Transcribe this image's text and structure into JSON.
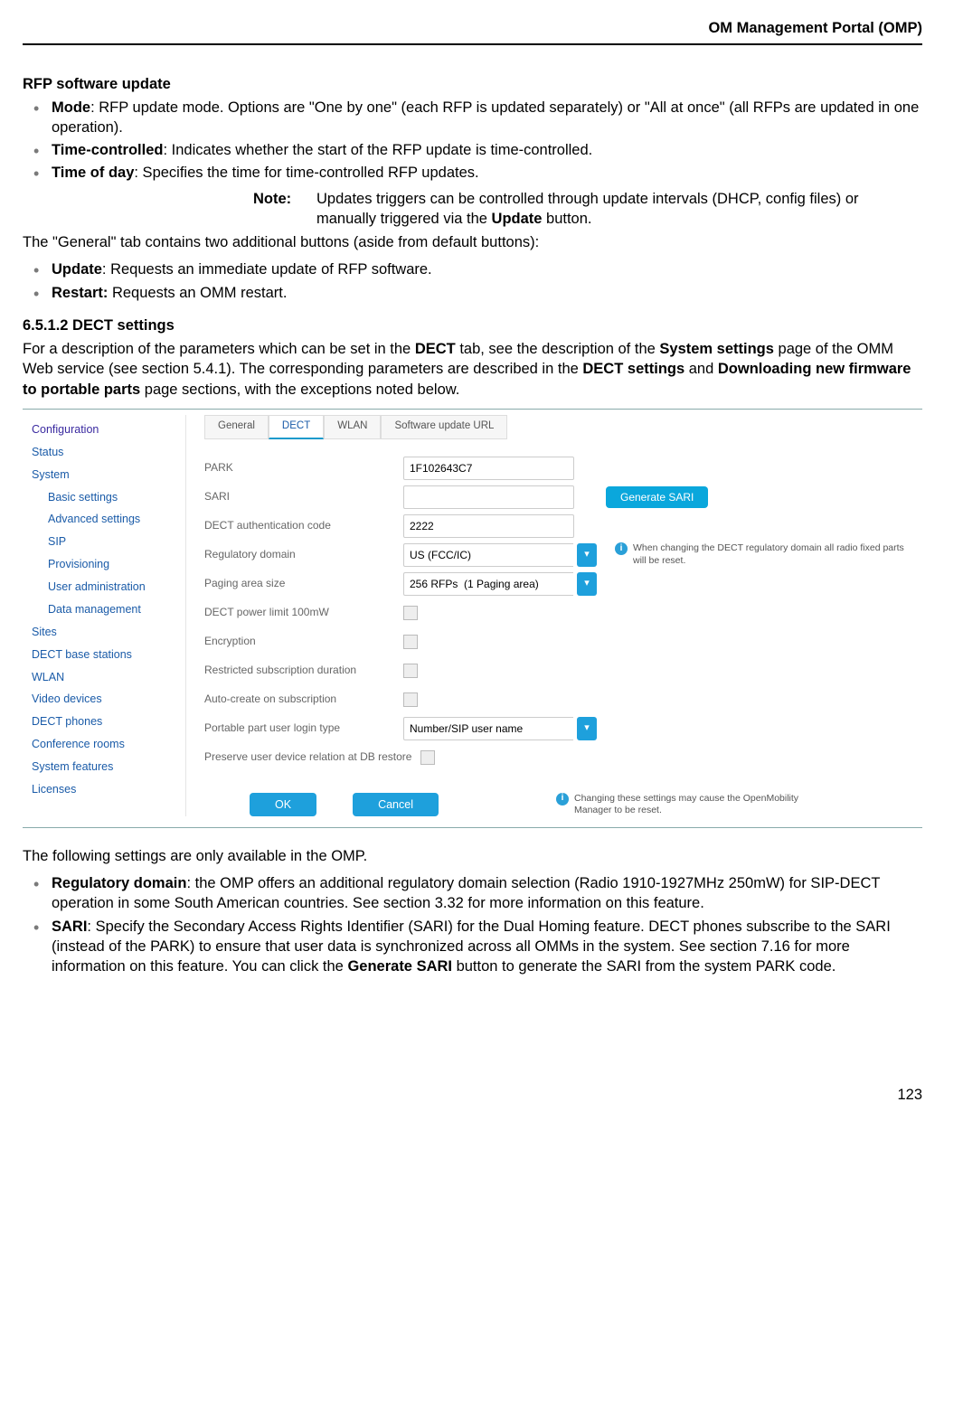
{
  "header": {
    "title": "OM Management Portal (OMP)"
  },
  "section1": {
    "title": "RFP software update",
    "items": [
      {
        "term": "Mode",
        "desc": ": RFP update mode. Options are \"One by one\" (each RFP is updated separately) or \"All at once\" (all RFPs are updated in one operation)."
      },
      {
        "term": "Time-controlled",
        "desc": ": Indicates whether the start of the RFP update is time-controlled."
      },
      {
        "term": "Time of day",
        "desc": ": Specifies the time for time-controlled RFP updates."
      }
    ],
    "note_label": "Note:",
    "note_text_a": "Updates triggers can be controlled through update intervals (DHCP, config files) or manually triggered via the ",
    "note_text_b": "Update",
    "note_text_c": " button.",
    "para2": "The \"General\" tab contains two additional buttons (aside from default buttons):",
    "items2": [
      {
        "term": "Update",
        "desc": ": Requests an immediate update of RFP software."
      },
      {
        "term": "Restart:",
        "desc": " Requests an OMM restart."
      }
    ]
  },
  "section2": {
    "heading": "6.5.1.2 DECT settings",
    "para_a": "For a description of the parameters which can be set in the ",
    "para_b": "DECT",
    "para_c": " tab, see the description of the ",
    "para_d": "System settings",
    "para_e": " page of the OMM Web service (see section 5.4.1). The corresponding parameters are described in the ",
    "para_f": "DECT settings",
    "para_g": " and ",
    "para_h": "Downloading new firmware to portable parts",
    "para_i": " page sections, with the exceptions noted below."
  },
  "screenshot": {
    "sidebar": {
      "top": [
        "Configuration",
        "Status",
        "System"
      ],
      "system_sub": [
        "Basic settings",
        "Advanced settings",
        "SIP",
        "Provisioning",
        "User administration",
        "Data management"
      ],
      "rest": [
        "Sites",
        "DECT base stations",
        "WLAN",
        "Video devices",
        "DECT phones",
        "Conference rooms",
        "System features",
        "Licenses"
      ]
    },
    "tabs": [
      "General",
      "DECT",
      "WLAN",
      "Software update URL"
    ],
    "form": {
      "park_label": "PARK",
      "park_val": "1F102643C7",
      "sari_label": "SARI",
      "sari_btn": "Generate SARI",
      "auth_label": "DECT authentication code",
      "auth_val": "2222",
      "reg_label": "Regulatory domain",
      "reg_val": "US (FCC/IC)",
      "reg_note": "When changing the DECT regulatory domain all radio fixed parts will be reset.",
      "page_label": "Paging area size",
      "page_val": "256 RFPs  (1 Paging area)",
      "pow_label": "DECT power limit 100mW",
      "enc_label": "Encryption",
      "rest_label": "Restricted subscription duration",
      "auto_label": "Auto-create on subscription",
      "login_label": "Portable part user login type",
      "login_val": "Number/SIP user name",
      "pres_label": "Preserve user device relation at DB restore",
      "ok": "OK",
      "cancel": "Cancel",
      "footer_note": "Changing these settings may cause the OpenMobility Manager to be reset."
    }
  },
  "section3": {
    "para": "The following settings are only available in the OMP.",
    "items": [
      {
        "term": "Regulatory domain",
        "desc": ": the OMP offers an additional regulatory domain selection (Radio 1910-1927MHz 250mW) for SIP-DECT operation in some South American countries. See section 3.32  for more information on this feature."
      },
      {
        "term": "SARI",
        "desc_a": ": Specify the Secondary Access Rights Identifier (SARI) for the Dual Homing feature. DECT phones subscribe to the SARI (instead of the PARK) to ensure that user data is synchronized across all OMMs in the system. See section 7.16 for more information on this feature. You can click the ",
        "desc_b": "Generate SARI",
        "desc_c": " button to generate the SARI from the system PARK code."
      }
    ]
  },
  "page_number": "123"
}
